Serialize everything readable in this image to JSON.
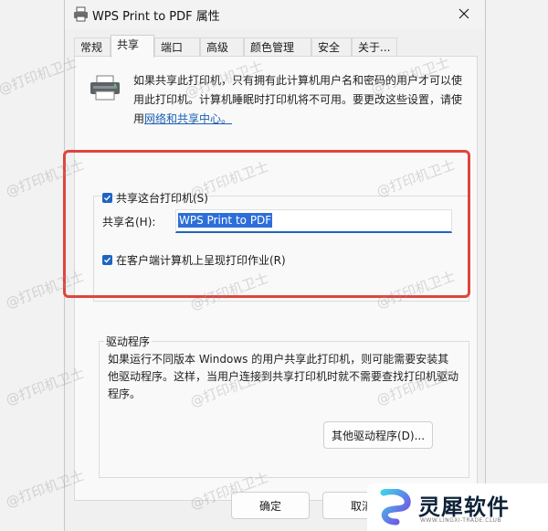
{
  "window": {
    "title": "WPS Print to PDF 属性"
  },
  "tabs": [
    {
      "label": "常规"
    },
    {
      "label": "共享"
    },
    {
      "label": "端口"
    },
    {
      "label": "高级"
    },
    {
      "label": "颜色管理"
    },
    {
      "label": "安全"
    },
    {
      "label": "关于..."
    }
  ],
  "sharing": {
    "description": "如果共享此打印机，只有拥有此计算机用户名和密码的用户才可以使用此打印机。计算机睡眠时打印机将不可用。要更改这些设置，请使用",
    "link": "网络和共享中心。",
    "share_checkbox_label": "共享这台打印机(S)",
    "share_name_label": "共享名(H):",
    "share_name_value": "WPS Print to PDF",
    "render_jobs_label": "在客户端计算机上呈现打印作业(R)"
  },
  "drivers": {
    "group_label": "驱动程序",
    "description": "如果运行不同版本 Windows 的用户共享此打印机，则可能需要安装其他驱动程序。这样，当用户连接到共享打印机时就不需要查找打印机驱动程序。",
    "button_label": "其他驱动程序(D)..."
  },
  "footer": {
    "ok_label": "确定",
    "cancel_label": "取消"
  },
  "watermark": {
    "text": "@打印机卫士"
  },
  "logo": {
    "name": "灵犀软件",
    "sub": "WWW.LINGXI-TRADE.CLUB"
  },
  "colors": {
    "accent": "#1f64c2",
    "highlight_box": "#e0443e"
  }
}
